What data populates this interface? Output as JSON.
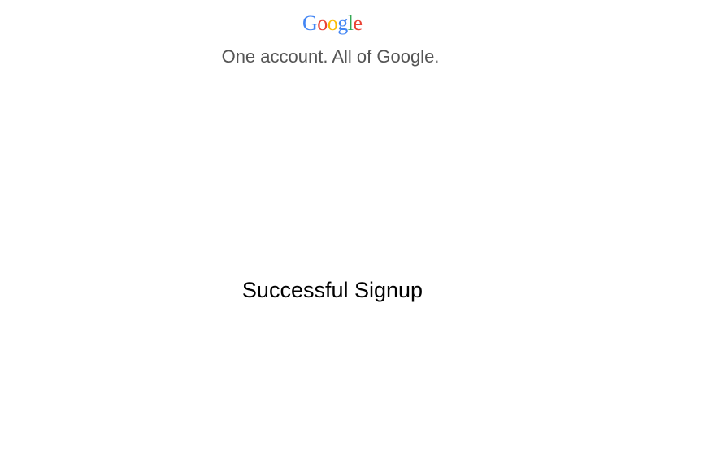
{
  "header": {
    "logo": {
      "text": "Google",
      "letters": [
        {
          "char": "G",
          "color": "#4285f4"
        },
        {
          "char": "o",
          "color": "#ea4335"
        },
        {
          "char": "o",
          "color": "#fbbc05"
        },
        {
          "char": "g",
          "color": "#4285f4"
        },
        {
          "char": "l",
          "color": "#34a853"
        },
        {
          "char": "e",
          "color": "#ea4335"
        }
      ]
    },
    "tagline": "One account. All of Google."
  },
  "main": {
    "message": "Successful Signup"
  },
  "colors": {
    "tagline": "#555555",
    "message": "#000000",
    "background": "#ffffff"
  }
}
